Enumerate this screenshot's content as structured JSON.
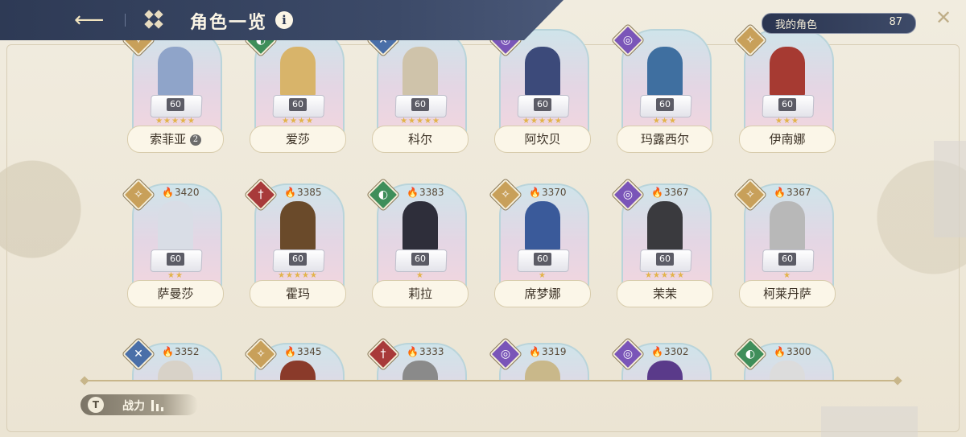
{
  "header": {
    "title": "角色一览",
    "info_glyph": "i",
    "back_glyph": "⟵",
    "close_glyph": "✕"
  },
  "count": {
    "label": "我的角色",
    "value": "87"
  },
  "sort": {
    "label": "战力",
    "icon_glyph": "T"
  },
  "colors": {
    "header_bg": "#2e3a55",
    "gold": "#c8b68a",
    "flame": "#e58a2a"
  },
  "rows": [
    {
      "cards": [
        {
          "name": "索菲亚",
          "power": "",
          "level": "60",
          "stars": "★★★★★",
          "class_color": "#c8a05a",
          "class_glyph": "✧",
          "figure_color": "#8fa4c9",
          "badge": "2"
        },
        {
          "name": "爱莎",
          "power": "",
          "level": "60",
          "stars": "★★★★",
          "class_color": "#3f8e5a",
          "class_glyph": "◐",
          "figure_color": "#d8b46a"
        },
        {
          "name": "科尔",
          "power": "",
          "level": "60",
          "stars": "★★★★★",
          "class_color": "#4a6fa8",
          "class_glyph": "✕",
          "figure_color": "#cfc3aa"
        },
        {
          "name": "阿坎贝",
          "power": "",
          "level": "60",
          "stars": "★★★★★",
          "class_color": "#7a55b8",
          "class_glyph": "◎",
          "figure_color": "#3c4a7a"
        },
        {
          "name": "玛露西尔",
          "power": "",
          "level": "60",
          "stars": "★★★",
          "class_color": "#7a55b8",
          "class_glyph": "◎",
          "figure_color": "#3f6fa0"
        },
        {
          "name": "伊南娜",
          "power": "",
          "level": "60",
          "stars": "★★★",
          "class_color": "#c8a05a",
          "class_glyph": "✧",
          "figure_color": "#a63a32"
        }
      ]
    },
    {
      "cards": [
        {
          "name": "萨曼莎",
          "power": "3420",
          "level": "60",
          "stars": "★★",
          "class_color": "#c8a05a",
          "class_glyph": "✧",
          "figure_color": "#d9dde6"
        },
        {
          "name": "霍玛",
          "power": "3385",
          "level": "60",
          "stars": "★★★★★",
          "class_color": "#a83a3a",
          "class_glyph": "†",
          "figure_color": "#6a4a2a"
        },
        {
          "name": "莉拉",
          "power": "3383",
          "level": "60",
          "stars": "★",
          "class_color": "#3f8e5a",
          "class_glyph": "◐",
          "figure_color": "#2e2e3a"
        },
        {
          "name": "席梦娜",
          "power": "3370",
          "level": "60",
          "stars": "★",
          "class_color": "#c8a05a",
          "class_glyph": "✧",
          "figure_color": "#3a5a9a"
        },
        {
          "name": "茉茉",
          "power": "3367",
          "level": "60",
          "stars": "★★★★★",
          "class_color": "#7a55b8",
          "class_glyph": "◎",
          "figure_color": "#3a3a3e"
        },
        {
          "name": "柯莱丹萨",
          "power": "3367",
          "level": "60",
          "stars": "★",
          "class_color": "#c8a05a",
          "class_glyph": "✧",
          "figure_color": "#b8b8b8"
        }
      ]
    },
    {
      "cards": [
        {
          "name": "",
          "power": "3352",
          "level": "",
          "stars": "",
          "class_color": "#4a6fa8",
          "class_glyph": "✕",
          "figure_color": "#d8d2c8"
        },
        {
          "name": "",
          "power": "3345",
          "level": "",
          "stars": "",
          "class_color": "#c8a05a",
          "class_glyph": "✧",
          "figure_color": "#8a3a2a"
        },
        {
          "name": "",
          "power": "3333",
          "level": "",
          "stars": "",
          "class_color": "#a83a3a",
          "class_glyph": "†",
          "figure_color": "#8a8a8a"
        },
        {
          "name": "",
          "power": "3319",
          "level": "",
          "stars": "",
          "class_color": "#7a55b8",
          "class_glyph": "◎",
          "figure_color": "#c9b88a"
        },
        {
          "name": "",
          "power": "3302",
          "level": "",
          "stars": "",
          "class_color": "#7a55b8",
          "class_glyph": "◎",
          "figure_color": "#5a3a8a"
        },
        {
          "name": "",
          "power": "3300",
          "level": "",
          "stars": "",
          "class_color": "#3f8e5a",
          "class_glyph": "◐",
          "figure_color": "#dcdcdc"
        }
      ]
    }
  ]
}
